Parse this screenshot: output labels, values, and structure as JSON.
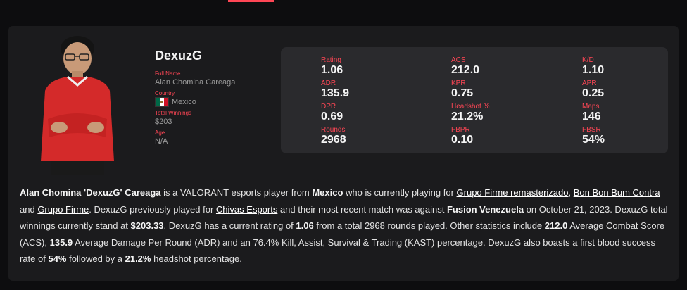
{
  "player": {
    "alias": "DexuzG",
    "full_name_label": "Full Name",
    "full_name": "Alan Chomina Careaga",
    "country_label": "Country",
    "country": "Mexico",
    "winnings_label": "Total Winnings",
    "winnings": "$203",
    "age_label": "Age",
    "age": "N/A"
  },
  "stats": [
    {
      "label": "Rating",
      "value": "1.06"
    },
    {
      "label": "ACS",
      "value": "212.0"
    },
    {
      "label": "K/D",
      "value": "1.10"
    },
    {
      "label": "ADR",
      "value": "135.9"
    },
    {
      "label": "KPR",
      "value": "0.75"
    },
    {
      "label": "APR",
      "value": "0.25"
    },
    {
      "label": "DPR",
      "value": "0.69"
    },
    {
      "label": "Headshot %",
      "value": "21.2%"
    },
    {
      "label": "Maps",
      "value": "146"
    },
    {
      "label": "Rounds",
      "value": "2968"
    },
    {
      "label": "FBPR",
      "value": "0.10"
    },
    {
      "label": "FBSR",
      "value": "54%"
    }
  ],
  "bio": {
    "full_name": "Alan Chomina 'DexuzG' Careaga",
    "t1": " is a VALORANT esports player from ",
    "country": "Mexico",
    "t2": " who is currently playing for ",
    "team1": "Grupo Firme remasterizado",
    "t3": ", ",
    "team2": "Bon Bon Bum Contra",
    "t4": " and ",
    "team3": "Grupo Firme",
    "t5": ". DexuzG previously played for ",
    "prev_team": "Chivas Esports",
    "t6": " and their most recent match was against ",
    "opponent": "Fusion Venezuela",
    "t7": " on October 21, 2023. DexuzG total winnings currently stand at ",
    "winnings": "$203.33",
    "t8": ". DexuzG has a current rating of ",
    "rating": "1.06",
    "t9": " from a total 2968 rounds played. Other statistics include ",
    "acs": "212.0",
    "t10": " Average Combat Score (ACS), ",
    "adr": "135.9",
    "t11": " Average Damage Per Round (ADR) and an 76.4% Kill, Assist, Survival & Trading (KAST) percentage. DexuzG also boasts a first blood success rate of ",
    "fbsr": "54%",
    "t12": " followed by a ",
    "hs": "21.2%",
    "t13": " headshot percentage."
  },
  "colors": {
    "accent": "#ff4655",
    "card": "#1b1b1d",
    "panel": "#2a2a2d",
    "background": "#0d0d0f"
  },
  "icons": {
    "flag": "mexico-flag-icon",
    "photo": "player-photo"
  }
}
